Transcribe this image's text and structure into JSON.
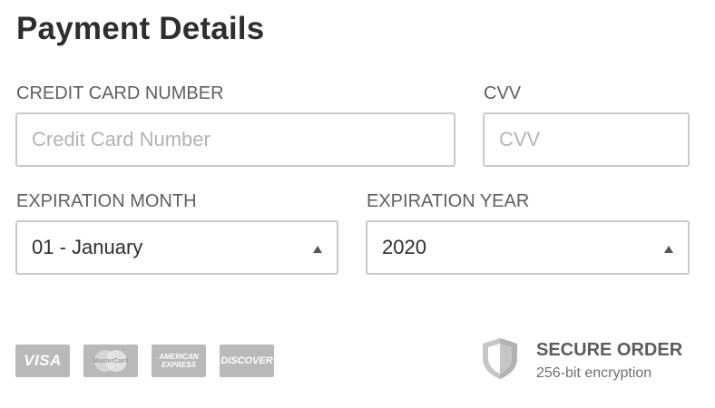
{
  "page": {
    "title": "Payment Details"
  },
  "card_number": {
    "label": "CREDIT CARD NUMBER",
    "placeholder": "Credit Card Number"
  },
  "cvv": {
    "label": "CVV",
    "placeholder": "CVV"
  },
  "expiration_month": {
    "label": "EXPIRATION MONTH",
    "selected": "01 - January"
  },
  "expiration_year": {
    "label": "EXPIRATION YEAR",
    "selected": "2020"
  },
  "card_logos": [
    {
      "name": "visa-icon",
      "text": "VISA"
    },
    {
      "name": "mastercard-icon",
      "text": "MasterCard"
    },
    {
      "name": "american-express-icon",
      "text": "AMERICAN EXPRESS"
    },
    {
      "name": "discover-icon",
      "text": "DISCOVER"
    }
  ],
  "secure": {
    "title": "SECURE ORDER",
    "subtitle": "256-bit encryption",
    "icon": "shield-icon"
  },
  "colors": {
    "text_dark": "#2e2e2e",
    "label": "#5f5f5f",
    "border": "#c9c9c9",
    "logo_gray": "#b9b9b9",
    "placeholder": "#b3b3b3"
  }
}
